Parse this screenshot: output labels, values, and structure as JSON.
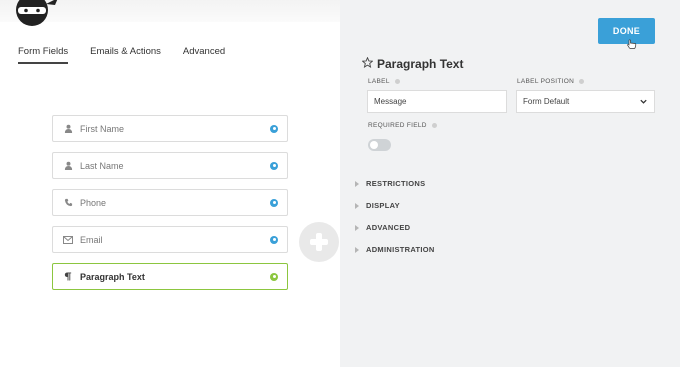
{
  "tabs": [
    {
      "label": "Form Fields",
      "active": true
    },
    {
      "label": "Emails & Actions",
      "active": false
    },
    {
      "label": "Advanced",
      "active": false
    }
  ],
  "fields": [
    {
      "label": "First Name",
      "icon": "user-icon"
    },
    {
      "label": "Last Name",
      "icon": "user-icon"
    },
    {
      "label": "Phone",
      "icon": "phone-icon"
    },
    {
      "label": "Email",
      "icon": "envelope-icon"
    },
    {
      "label": "Paragraph Text",
      "icon": "paragraph-icon",
      "active": true
    }
  ],
  "done_label": "DONE",
  "panel": {
    "title": "Paragraph Text",
    "label_caption": "LABEL",
    "label_value": "Message",
    "label_position_caption": "LABEL POSITION",
    "label_position_value": "Form Default",
    "required_caption": "REQUIRED FIELD",
    "required_on": false
  },
  "sections": [
    "RESTRICTIONS",
    "DISPLAY",
    "ADVANCED",
    "ADMINISTRATION"
  ],
  "colors": {
    "accent": "#3aa0d8",
    "active_field": "#8cc63f",
    "right_pane_bg": "#f1f2f3"
  }
}
